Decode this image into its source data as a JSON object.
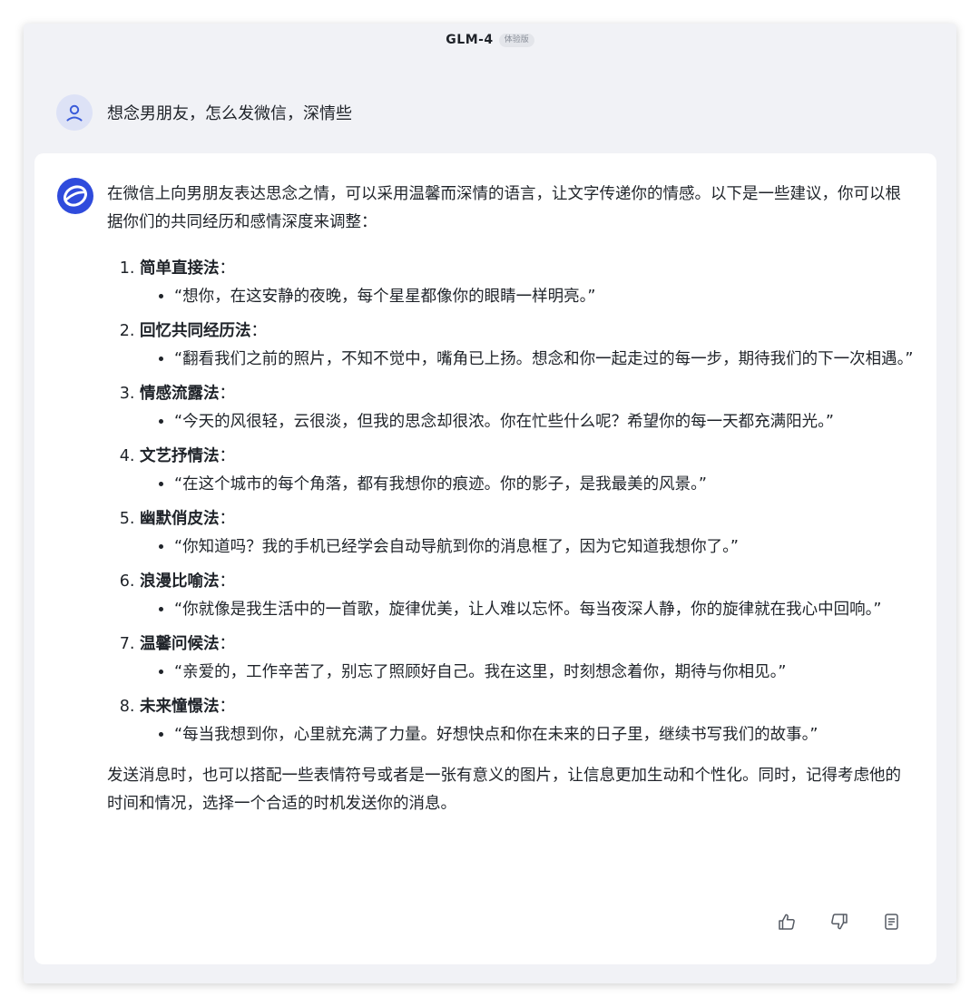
{
  "header": {
    "title": "GLM-4",
    "badge": "体验版"
  },
  "user_message": {
    "text": "想念男朋友，怎么发微信，深情些"
  },
  "answer": {
    "intro": "在微信上向男朋友表达思念之情，可以采用温馨而深情的语言，让文字传递你的情感。以下是一些建议，你可以根据你们的共同经历和感情深度来调整：",
    "items": [
      {
        "title": "简单直接法",
        "colon": "：",
        "example": "“想你，在这安静的夜晚，每个星星都像你的眼睛一样明亮。”"
      },
      {
        "title": "回忆共同经历法",
        "colon": "：",
        "example": "“翻看我们之前的照片，不知不觉中，嘴角已上扬。想念和你一起走过的每一步，期待我们的下一次相遇。”"
      },
      {
        "title": "情感流露法",
        "colon": "：",
        "example": "“今天的风很轻，云很淡，但我的思念却很浓。你在忙些什么呢？希望你的每一天都充满阳光。”"
      },
      {
        "title": "文艺抒情法",
        "colon": "：",
        "example": "“在这个城市的每个角落，都有我想你的痕迹。你的影子，是我最美的风景。”"
      },
      {
        "title": "幽默俏皮法",
        "colon": "：",
        "example": "“你知道吗？我的手机已经学会自动导航到你的消息框了，因为它知道我想你了。”"
      },
      {
        "title": "浪漫比喻法",
        "colon": "：",
        "example": "“你就像是我生活中的一首歌，旋律优美，让人难以忘怀。每当夜深人静，你的旋律就在我心中回响。”"
      },
      {
        "title": "温馨问候法",
        "colon": "：",
        "example": "“亲爱的，工作辛苦了，别忘了照顾好自己。我在这里，时刻想念着你，期待与你相见。”"
      },
      {
        "title": "未来憧憬法",
        "colon": "：",
        "example": "“每当我想到你，心里就充满了力量。好想快点和你在未来的日子里，继续书写我们的故事。”"
      }
    ],
    "outro": "发送消息时，也可以搭配一些表情符号或者是一张有意义的图片，让信息更加生动和个性化。同时，记得考虑他的时间和情况，选择一个合适的时机发送你的消息。"
  },
  "actions": [
    {
      "icon": "thumbs-up-icon"
    },
    {
      "icon": "thumbs-down-icon"
    },
    {
      "icon": "copy-icon"
    }
  ],
  "colors": {
    "accent": "#2f4bdc",
    "user_avatar_bg": "#dde2f6",
    "page_bg": "#f1f2f6"
  }
}
